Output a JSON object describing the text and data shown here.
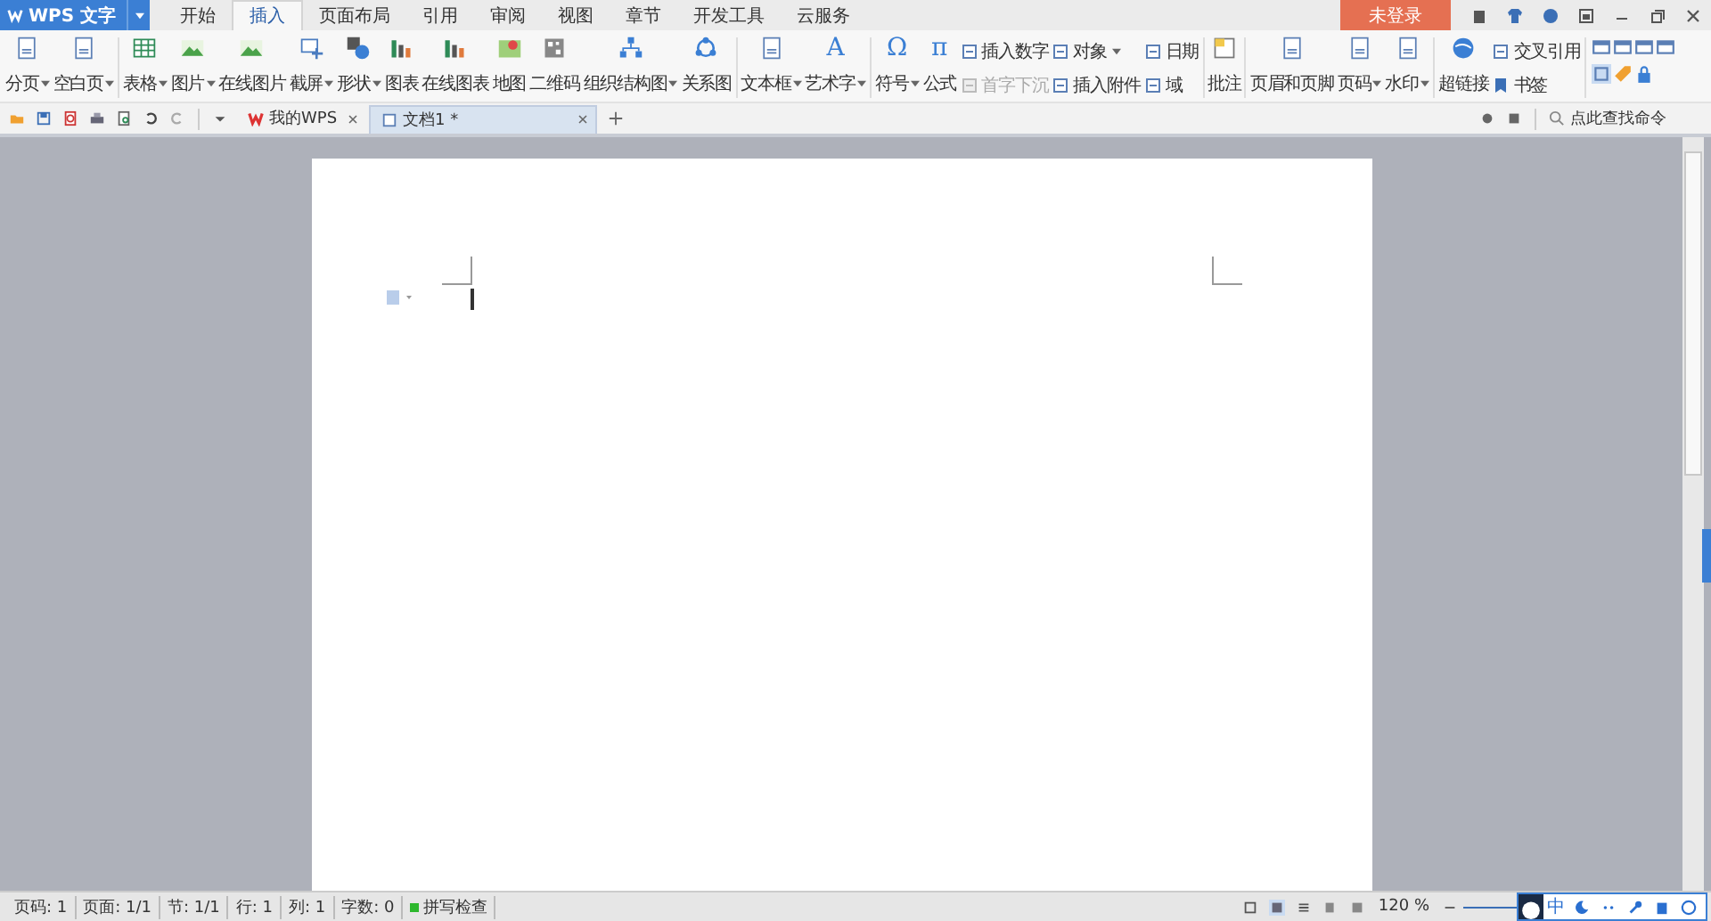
{
  "app_button": {
    "label": "WPS 文字"
  },
  "tabs": [
    {
      "label": "开始",
      "selected": false
    },
    {
      "label": "插入",
      "selected": true
    },
    {
      "label": "页面布局",
      "selected": false
    },
    {
      "label": "引用",
      "selected": false
    },
    {
      "label": "审阅",
      "selected": false
    },
    {
      "label": "视图",
      "selected": false
    },
    {
      "label": "章节",
      "selected": false
    },
    {
      "label": "开发工具",
      "selected": false
    },
    {
      "label": "云服务",
      "selected": false
    }
  ],
  "login_button": {
    "label": "未登录"
  },
  "ribbon": {
    "items": [
      {
        "kind": "large",
        "label": "分页",
        "dropdown": true
      },
      {
        "kind": "large",
        "label": "空白页",
        "dropdown": true
      },
      {
        "kind": "separator"
      },
      {
        "kind": "large",
        "label": "表格",
        "dropdown": true
      },
      {
        "kind": "large",
        "label": "图片",
        "dropdown": true
      },
      {
        "kind": "large",
        "label": "在线图片",
        "dropdown": false
      },
      {
        "kind": "large",
        "label": "截屏",
        "dropdown": true
      },
      {
        "kind": "large",
        "label": "形状",
        "dropdown": true
      },
      {
        "kind": "large",
        "label": "图表",
        "dropdown": false
      },
      {
        "kind": "large",
        "label": "在线图表",
        "dropdown": false
      },
      {
        "kind": "large",
        "label": "地图",
        "dropdown": false
      },
      {
        "kind": "large",
        "label": "二维码",
        "dropdown": false
      },
      {
        "kind": "large",
        "label": "组织结构图",
        "dropdown": true
      },
      {
        "kind": "large",
        "label": "关系图",
        "dropdown": false
      },
      {
        "kind": "separator"
      },
      {
        "kind": "large",
        "label": "文本框",
        "dropdown": true
      },
      {
        "kind": "large",
        "label": "艺术字",
        "dropdown": true,
        "glyph": "A"
      },
      {
        "kind": "separator"
      },
      {
        "kind": "large",
        "label": "符号",
        "dropdown": true,
        "glyph": "Ω"
      },
      {
        "kind": "large",
        "label": "公式",
        "dropdown": false,
        "glyph": "π"
      },
      {
        "kind": "stack",
        "rows": [
          {
            "label": "插入数字",
            "disabled": false,
            "dropdown": false
          },
          {
            "label": "首字下沉",
            "disabled": true,
            "dropdown": false
          }
        ]
      },
      {
        "kind": "stack",
        "rows": [
          {
            "label": "对象",
            "disabled": false,
            "dropdown": true
          },
          {
            "label": "插入附件",
            "disabled": false,
            "dropdown": false
          }
        ]
      },
      {
        "kind": "stack",
        "rows": [
          {
            "label": "日期",
            "disabled": false,
            "dropdown": false
          },
          {
            "label": "域",
            "disabled": false,
            "dropdown": false
          }
        ]
      },
      {
        "kind": "separator"
      },
      {
        "kind": "large",
        "label": "批注",
        "dropdown": false
      },
      {
        "kind": "separator"
      },
      {
        "kind": "large",
        "label": "页眉和页脚",
        "dropdown": false
      },
      {
        "kind": "large",
        "label": "页码",
        "dropdown": true
      },
      {
        "kind": "large",
        "label": "水印",
        "dropdown": true
      },
      {
        "kind": "separator"
      },
      {
        "kind": "large",
        "label": "超链接",
        "dropdown": false
      },
      {
        "kind": "stack",
        "rows": [
          {
            "label": "交叉引用",
            "disabled": false,
            "dropdown": false
          },
          {
            "label": "书签",
            "disabled": false,
            "dropdown": false
          }
        ]
      },
      {
        "kind": "separator"
      },
      {
        "kind": "icon_grid"
      }
    ]
  },
  "doc_tabs": [
    {
      "label": "我的WPS",
      "selected": false
    },
    {
      "label": "文档1 *",
      "selected": true
    }
  ],
  "command_search": {
    "placeholder": "点此查找命令"
  },
  "status_bar": {
    "items": [
      "页码: 1",
      "页面: 1/1",
      "节: 1/1",
      "行: 1",
      "列: 1",
      "字数: 0"
    ],
    "spell_check": {
      "label": "拼写检查",
      "on": true
    },
    "zoom": "120 %"
  },
  "ime_bar": {
    "label": "中"
  }
}
